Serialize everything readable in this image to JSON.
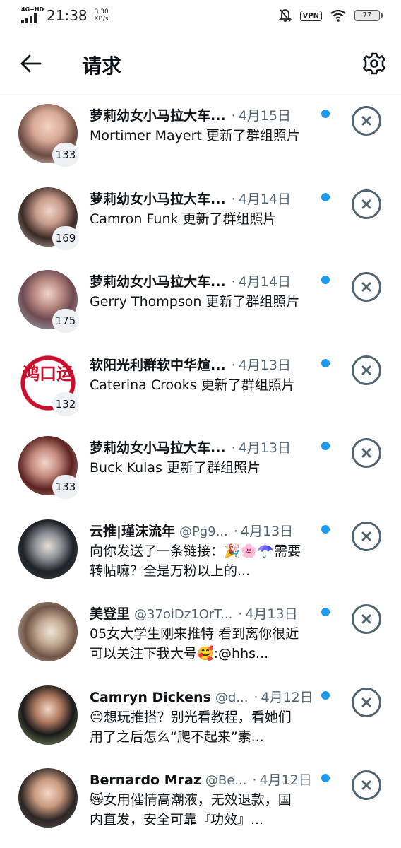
{
  "status_bar": {
    "network": "4G+HD",
    "time": "21:38",
    "speed_value": "3.30",
    "speed_unit": "KB/s",
    "vpn": "VPN",
    "battery": "77"
  },
  "header": {
    "title": "请求"
  },
  "requests": [
    {
      "name": "萝莉幼女小马拉大车...",
      "handle": "",
      "date": "4月15日",
      "message": "Mortimer Mayert 更新了群组照片",
      "count": "133"
    },
    {
      "name": "萝莉幼女小马拉大车...",
      "handle": "",
      "date": "4月14日",
      "message": "Camron Funk 更新了群组照片",
      "count": "169"
    },
    {
      "name": "萝莉幼女小马拉大车...",
      "handle": "",
      "date": "4月14日",
      "message": "Gerry Thompson 更新了群组照片",
      "count": "175"
    },
    {
      "name": "软阳光利群软中华煊...",
      "handle": "",
      "date": "4月13日",
      "message": "Caterina Crooks 更新了群组照片",
      "count": "132",
      "avatar_text": "鸿口运"
    },
    {
      "name": "萝莉幼女小马拉大车...",
      "handle": "",
      "date": "4月13日",
      "message": "Buck Kulas 更新了群组照片",
      "count": "133"
    },
    {
      "name": "云推|瑾沫流年",
      "handle": "@Pg9...",
      "date": "4月13日",
      "message": "向你发送了一条链接：🎉🌸☂️需要转帖嘛？全是万粉以上的...",
      "count": ""
    },
    {
      "name": "美登里",
      "handle": "@37oiDz1OrT...",
      "date": "4月13日",
      "message": "05女大学生刚来推特 看到离你很近 可以关注下我大号🥰:@hhs...",
      "count": ""
    },
    {
      "name": "Camryn Dickens",
      "handle": "@d...",
      "date": "4月12日",
      "message": "😑想玩推搭？别光看教程，看她们用了之后怎么“爬不起来”素...",
      "count": ""
    },
    {
      "name": "Bernardo Mraz",
      "handle": "@Be...",
      "date": "4月12日",
      "message": "😿女用催情高潮液，无效退款，国内直发，安全可靠『功效』...",
      "count": ""
    }
  ],
  "colors": {
    "unread": "#1d9bf0",
    "secondary_text": "#536471",
    "divider": "#e6e9ec"
  },
  "icons": [
    "back-arrow-icon",
    "gear-icon",
    "close-icon"
  ]
}
